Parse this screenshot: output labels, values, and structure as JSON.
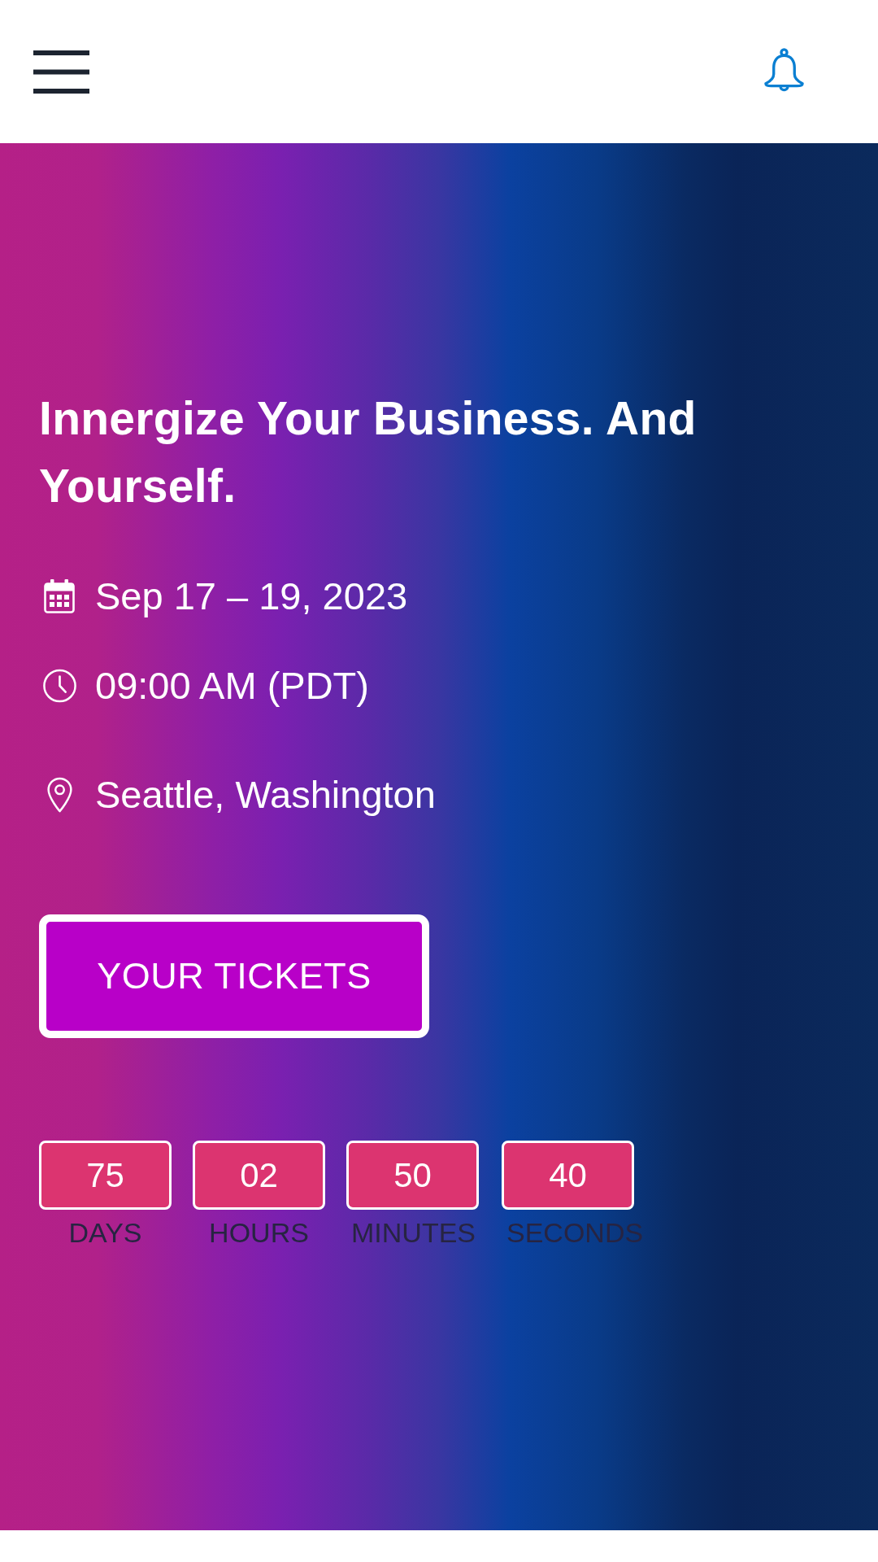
{
  "hero": {
    "title": "Innergize Your Business. And Yourself.",
    "details": [
      {
        "kind": "date",
        "text": "Sep 17 – 19, 2023"
      },
      {
        "kind": "time",
        "text": "09:00 AM (PDT)"
      },
      {
        "kind": "location",
        "text": "Seattle, Washington"
      }
    ],
    "button": "YOUR TICKETS",
    "countdown": [
      {
        "value": "75",
        "unit": "DAYS"
      },
      {
        "value": "02",
        "unit": "HOURS"
      },
      {
        "value": "50",
        "unit": "MINUTES"
      },
      {
        "value": "40",
        "unit": "SECONDS"
      }
    ]
  }
}
